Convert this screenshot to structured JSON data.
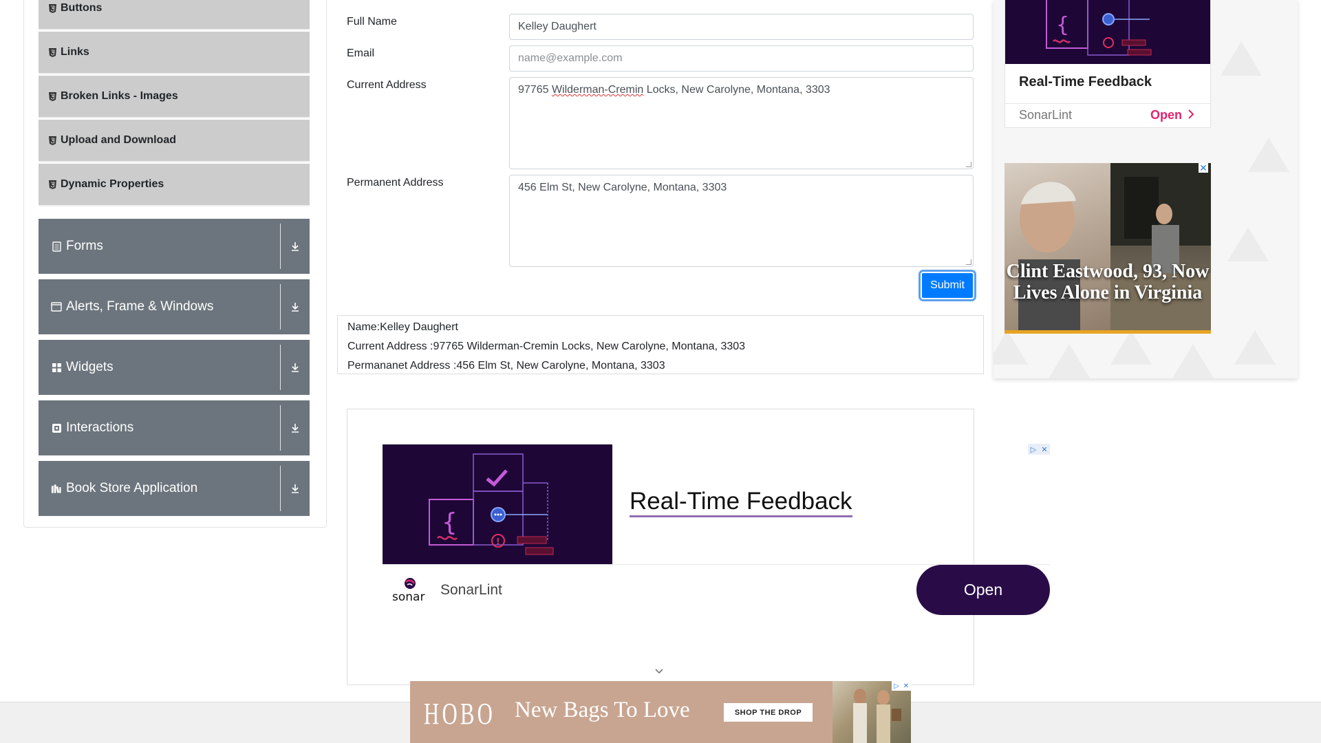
{
  "sidebar": {
    "sub_items": [
      {
        "label": "Buttons"
      },
      {
        "label": "Links"
      },
      {
        "label": "Broken Links - Images"
      },
      {
        "label": "Upload and Download"
      },
      {
        "label": "Dynamic Properties"
      }
    ],
    "groups": [
      {
        "label": "Forms",
        "icon": "form-icon"
      },
      {
        "label": "Alerts, Frame & Windows",
        "icon": "window-icon"
      },
      {
        "label": "Widgets",
        "icon": "widgets-icon"
      },
      {
        "label": "Interactions",
        "icon": "interactions-icon"
      },
      {
        "label": "Book Store Application",
        "icon": "books-icon"
      }
    ]
  },
  "form": {
    "full_name_label": "Full Name",
    "full_name_value": "Kelley Daughert",
    "email_label": "Email",
    "email_placeholder": "name@example.com",
    "current_address_label": "Current Address",
    "current_address_value_a": "97765 ",
    "current_address_value_b": "Wilderman-Cremin",
    "current_address_value_c": " Locks, New Carolyne, Montana, 3303",
    "permanent_address_label": "Permanent Address",
    "permanent_address_value": "456 Elm St, New Carolyne, Montana, 3303",
    "submit_label": "Submit"
  },
  "output": {
    "name_line": "Name:Kelley Daughert",
    "current_line": "Current Address :97765 Wilderman-Cremin Locks, New Carolyne, Montana, 3303",
    "permanent_line": "Permananet Address :456 Elm St, New Carolyne, Montana, 3303"
  },
  "mid_ad": {
    "title": "Real-Time Feedback",
    "brand": "SonarLint",
    "logo_text": "sonar",
    "cta": "Open",
    "badge_icons": [
      "adchoices-icon",
      "close-icon"
    ]
  },
  "right_ad": {
    "title": "Real-Time Feedback",
    "brand": "SonarLint",
    "cta": "Open",
    "news_headline": "Clint Eastwood, 93, Now Lives Alone in Virginia"
  },
  "bottom_ad": {
    "logo": "HOBO",
    "tagline": "New Bags To Love",
    "cta": "SHOP THE DROP"
  },
  "colors": {
    "accent_blue": "#007bff",
    "group_gray": "#6c757d",
    "sub_item_gray": "#cccccc",
    "sonar_purple": "#290c47",
    "sonar_pink": "#e0246e"
  }
}
